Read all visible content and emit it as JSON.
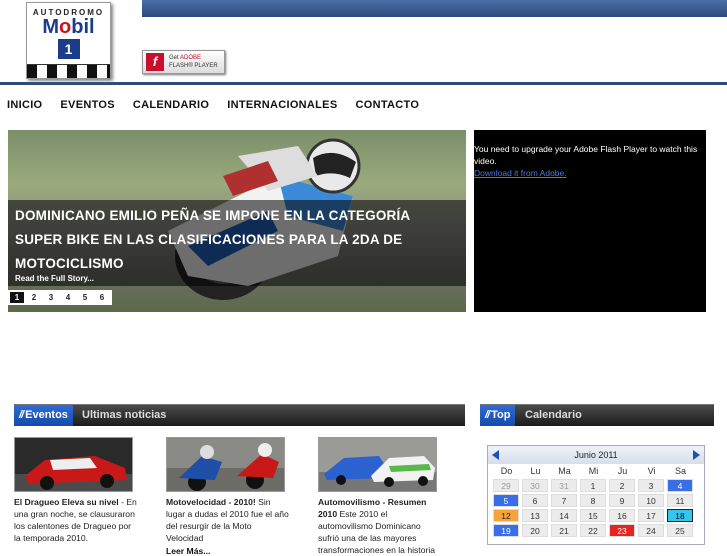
{
  "header": {
    "logo": {
      "line1": "AUTODROMO",
      "brand_m": "M",
      "brand_o": "o",
      "brand_rest": "bil",
      "badge": "1"
    },
    "flash_button": {
      "line1_prefix": "Get ",
      "line1_brand": "ADOBE",
      "line2": "FLASH® PLAYER"
    }
  },
  "nav": {
    "items": [
      "INICIO",
      "EVENTOS",
      "CALENDARIO",
      "INTERNACIONALES",
      "CONTACTO"
    ]
  },
  "slider": {
    "headline": "DOMINICANO EMILIO PEÑA SE IMPONE EN LA CATEGORÍA SUPER BIKE EN LAS CLASIFICACIONES PARA LA 2DA DE MOTOCICLISMO",
    "read_more": "Read the Full Story...",
    "pages": [
      "1",
      "2",
      "3",
      "4",
      "5",
      "6"
    ],
    "active_page": "1"
  },
  "video": {
    "message": "You need to upgrade your Adobe Flash Player to watch this video.",
    "link": "Download it from Adobe."
  },
  "eventos_section": {
    "tag": "Eventos",
    "title": "Ultimas noticias",
    "slashes": "//"
  },
  "calendar_section": {
    "tag": "Top",
    "title": "Calendario",
    "slashes": "//"
  },
  "news": [
    {
      "title": "El Dragueo Eleva su nivel",
      "text": " - En una gran noche, se clausuraron los calentones de Dragueo por la temporada 2010."
    },
    {
      "title": "Motovelocidad - 2010!",
      "text": " Sin lugar a dudas el 2010 fue el año del resurgir de la Moto Velocidad",
      "more": "Leer Más..."
    },
    {
      "title": "Automovilismo - Resumen 2010",
      "text": " Este 2010 el automovilismo Dominicano sufrió una de las mayores transformaciones en la historia"
    }
  ],
  "calendar": {
    "month": "Junio 2011",
    "weekdays": [
      "Do",
      "Lu",
      "Ma",
      "Mi",
      "Ju",
      "Vi",
      "Sa"
    ],
    "rows": [
      [
        "29",
        "30",
        "31",
        "1",
        "2",
        "3",
        "4"
      ],
      [
        "5",
        "6",
        "7",
        "8",
        "9",
        "10",
        "11"
      ],
      [
        "12",
        "13",
        "14",
        "15",
        "16",
        "17",
        "18"
      ],
      [
        "19",
        "20",
        "21",
        "22",
        "23",
        "24",
        "25"
      ]
    ],
    "colors": {
      "event": "#3a6ee8",
      "highlight": "#f5a33a",
      "today": "#35c6ef",
      "race": "#e8231e"
    }
  }
}
